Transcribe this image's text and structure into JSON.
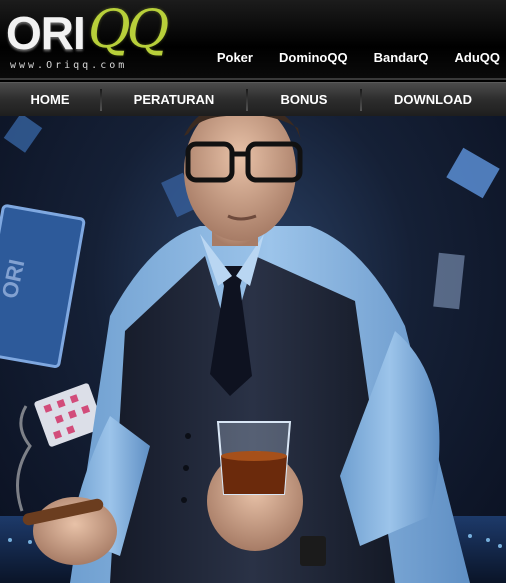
{
  "brand": {
    "name_part1": "ORI",
    "name_part2": "QQ",
    "url": "www.Oriqq.com",
    "accent_color": "#b8d03a"
  },
  "game_links": [
    {
      "label": "Poker"
    },
    {
      "label": "DominoQQ"
    },
    {
      "label": "BandarQ"
    },
    {
      "label": "AduQQ"
    }
  ],
  "nav": [
    {
      "label": "HOME"
    },
    {
      "label": "PERATURAN"
    },
    {
      "label": "BONUS"
    },
    {
      "label": "DOWNLOAD"
    }
  ],
  "hero": {
    "card_text": "ORI"
  }
}
